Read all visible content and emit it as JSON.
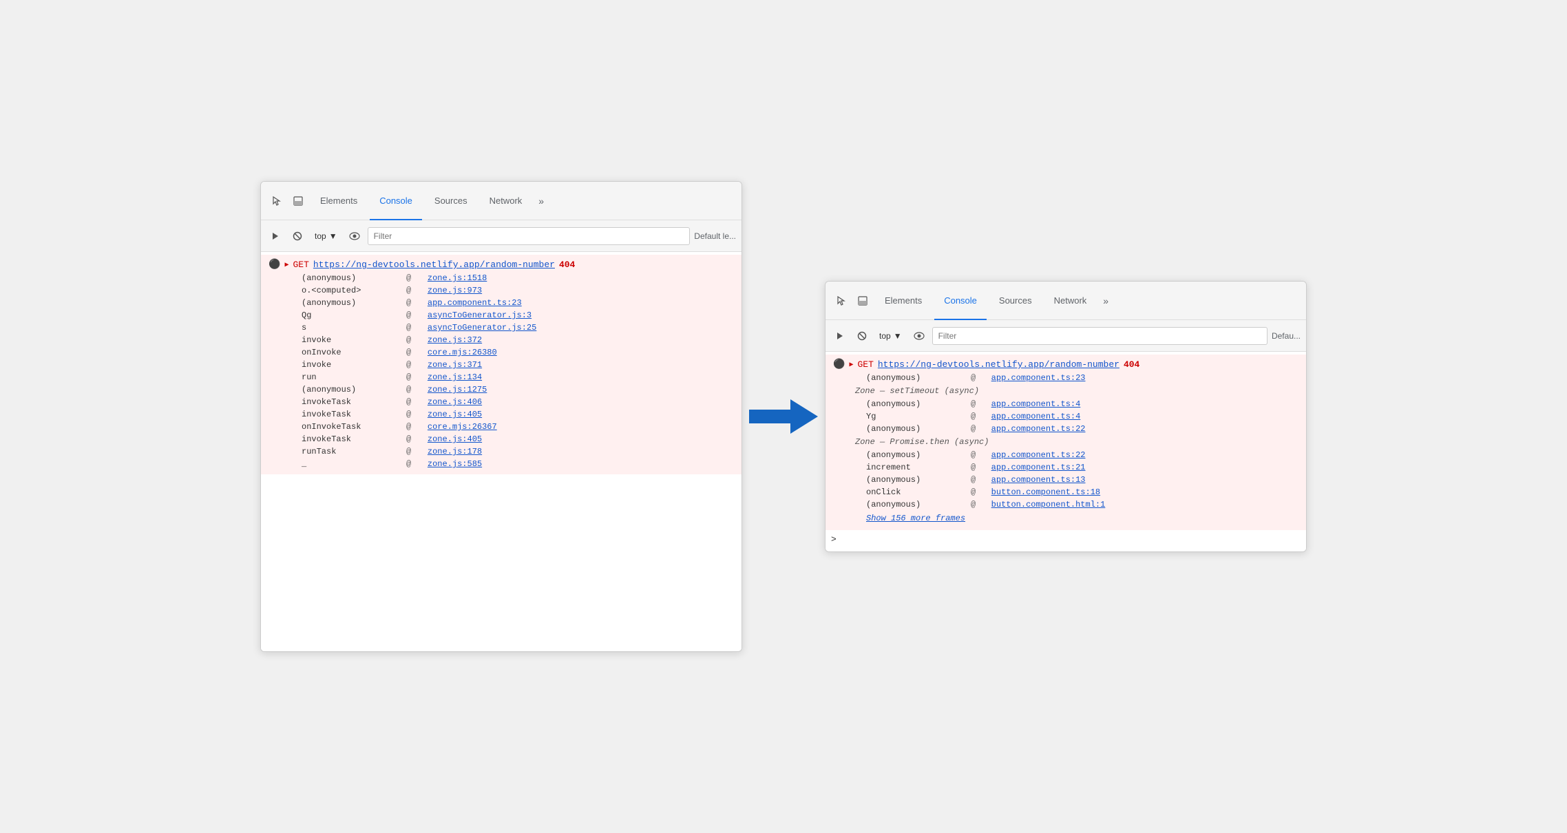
{
  "left_panel": {
    "tabs": [
      {
        "id": "elements",
        "label": "Elements",
        "active": false
      },
      {
        "id": "console",
        "label": "Console",
        "active": true
      },
      {
        "id": "sources",
        "label": "Sources",
        "active": false
      },
      {
        "id": "network",
        "label": "Network",
        "active": false
      }
    ],
    "toolbar": {
      "context": "top",
      "filter_placeholder": "Filter",
      "default_levels": "Default le..."
    },
    "error": {
      "method": "GET",
      "url": "https://ng-devtools.netlify.app/random-number",
      "status": "404"
    },
    "stack_frames": [
      {
        "fn": "(anonymous)",
        "at_sign": "@",
        "file": "zone.js:1518"
      },
      {
        "fn": "o.<computed>",
        "at_sign": "@",
        "file": "zone.js:973"
      },
      {
        "fn": "(anonymous)",
        "at_sign": "@",
        "file": "app.component.ts:23"
      },
      {
        "fn": "Qg",
        "at_sign": "@",
        "file": "asyncToGenerator.js:3"
      },
      {
        "fn": "s",
        "at_sign": "@",
        "file": "asyncToGenerator.js:25"
      },
      {
        "fn": "invoke",
        "at_sign": "@",
        "file": "zone.js:372"
      },
      {
        "fn": "onInvoke",
        "at_sign": "@",
        "file": "core.mjs:26380"
      },
      {
        "fn": "invoke",
        "at_sign": "@",
        "file": "zone.js:371"
      },
      {
        "fn": "run",
        "at_sign": "@",
        "file": "zone.js:134"
      },
      {
        "fn": "(anonymous)",
        "at_sign": "@",
        "file": "zone.js:1275"
      },
      {
        "fn": "invokeTask",
        "at_sign": "@",
        "file": "zone.js:406"
      },
      {
        "fn": "invokeTask",
        "at_sign": "@",
        "file": "zone.js:405"
      },
      {
        "fn": "onInvokeTask",
        "at_sign": "@",
        "file": "core.mjs:26367"
      },
      {
        "fn": "invokeTask",
        "at_sign": "@",
        "file": "zone.js:405"
      },
      {
        "fn": "runTask",
        "at_sign": "@",
        "file": "zone.js:178"
      },
      {
        "fn": "_",
        "at_sign": "@",
        "file": "zone.js:585"
      }
    ]
  },
  "right_panel": {
    "tabs": [
      {
        "id": "elements",
        "label": "Elements",
        "active": false
      },
      {
        "id": "console",
        "label": "Console",
        "active": true
      },
      {
        "id": "sources",
        "label": "Sources",
        "active": false
      },
      {
        "id": "network",
        "label": "Network",
        "active": false
      }
    ],
    "toolbar": {
      "context": "top",
      "filter_placeholder": "Filter",
      "default_levels": "Defau..."
    },
    "error": {
      "method": "GET",
      "url": "https://ng-devtools.netlify.app/random-number",
      "status": "404"
    },
    "stack_frames": [
      {
        "fn": "(anonymous)",
        "at_sign": "@",
        "file": "app.component.ts:23"
      },
      {
        "async_label": "Zone — setTimeout (async)"
      },
      {
        "fn": "(anonymous)",
        "at_sign": "@",
        "file": "app.component.ts:4"
      },
      {
        "fn": "Yg",
        "at_sign": "@",
        "file": "app.component.ts:4"
      },
      {
        "fn": "(anonymous)",
        "at_sign": "@",
        "file": "app.component.ts:22"
      },
      {
        "async_label": "Zone — Promise.then (async)"
      },
      {
        "fn": "(anonymous)",
        "at_sign": "@",
        "file": "app.component.ts:22"
      },
      {
        "fn": "increment",
        "at_sign": "@",
        "file": "app.component.ts:21"
      },
      {
        "fn": "(anonymous)",
        "at_sign": "@",
        "file": "app.component.ts:13"
      },
      {
        "fn": "onClick",
        "at_sign": "@",
        "file": "button.component.ts:18"
      },
      {
        "fn": "(anonymous)",
        "at_sign": "@",
        "file": "button.component.html:1"
      }
    ],
    "show_more": "Show 156 more frames",
    "prompt": ">"
  }
}
